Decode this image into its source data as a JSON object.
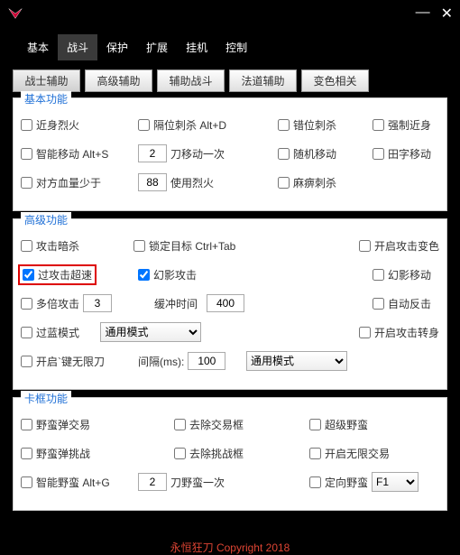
{
  "titlebar": {
    "minimize": "—",
    "close": "✕"
  },
  "tabs": [
    "基本",
    "战斗",
    "保护",
    "扩展",
    "挂机",
    "控制"
  ],
  "active_tab": 1,
  "subtabs": [
    "战士辅助",
    "高级辅助",
    "辅助战斗",
    "法道辅助",
    "变色相关"
  ],
  "active_subtab": 0,
  "sec_basic": {
    "title": "基本功能",
    "near_fire": "近身烈火",
    "gap_stab": "隔位刺杀 Alt+D",
    "wrong_stab": "错位刺杀",
    "force_near": "强制近身",
    "smart_move": "智能移动 Alt+S",
    "smart_move_val": "2",
    "knife_once": "刀移动一次",
    "random_move": "随机移动",
    "tian_move": "田字移动",
    "hp_less": "对方血量少于",
    "hp_val": "88",
    "use_fire": "使用烈火",
    "paralyze": "麻痹刺杀"
  },
  "sec_adv": {
    "title": "高级功能",
    "dark_attack": "攻击暗杀",
    "lock_target": "锁定目标 Ctrl+Tab",
    "open_color": "开启攻击变色",
    "over_speed": "过攻击超速",
    "phantom_attack": "幻影攻击",
    "phantom_move": "幻影移动",
    "multi_attack": "多倍攻击",
    "multi_val": "3",
    "buffer_time": "缓冲时间",
    "buffer_val": "400",
    "auto_counter": "自动反击",
    "over_blue": "过蓝模式",
    "mode_opt": "通用模式",
    "open_turn": "开启攻击转身",
    "open_unlim": "开启`键无限刀",
    "interval": "间隔(ms):",
    "interval_val": "100",
    "mode2_opt": "通用模式"
  },
  "sec_stuck": {
    "title": "卡框功能",
    "wild_trade": "野蛮弹交易",
    "remove_trade": "去除交易框",
    "super_wild": "超级野蛮",
    "wild_challenge": "野蛮弹挑战",
    "remove_challenge": "去除挑战框",
    "open_unlim_trade": "开启无限交易",
    "smart_wild": "智能野蛮 Alt+G",
    "smart_wild_val": "2",
    "knife_wild_once": "刀野蛮一次",
    "direct_wild": "定向野蛮",
    "fkey_opt": "F1"
  },
  "footer": "永恒狂刀   Copyright 2018"
}
